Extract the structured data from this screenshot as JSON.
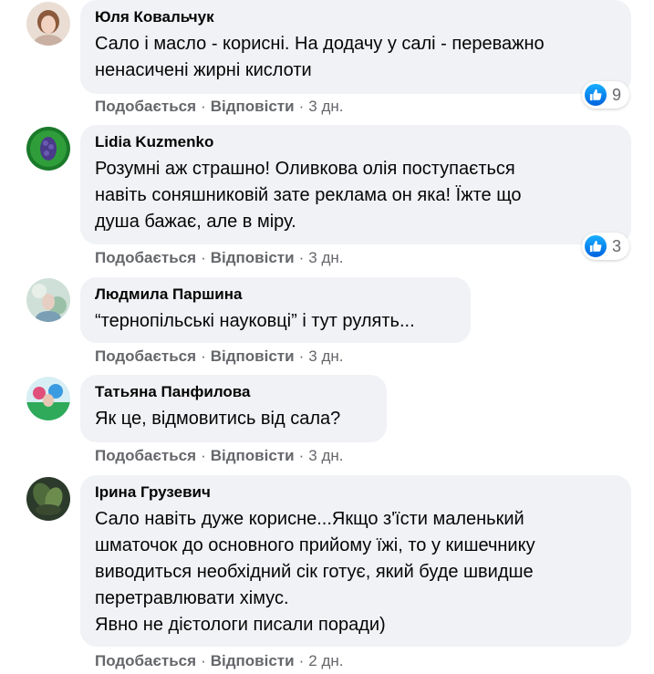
{
  "ui": {
    "like_label": "Подобається",
    "reply_label": "Відповісти",
    "separator": "·"
  },
  "comments": [
    {
      "author": "Юля Ковальчук",
      "text": "Сало і масло - корисні. На додачу у салі - переважно\nненасичені жирні кислоти",
      "time": "3 дн.",
      "reactions": {
        "icon": "like-icon",
        "count": "9"
      }
    },
    {
      "author": "Lidia Kuzmenko",
      "text": "Розумні аж страшно! Оливкова олія поступається\nнавіть соняшниковій зате реклама он яка! Їжте що\nдуша бажає, але в міру.",
      "time": "3 дн.",
      "reactions": {
        "icon": "like-icon",
        "count": "3"
      }
    },
    {
      "author": "Людмила Паршина",
      "text": "“тернопільські науковці” і тут рулять...",
      "time": "3 дн."
    },
    {
      "author": "Татьяна Панфилова",
      "text": "Як це, відмовитись від сала?",
      "time": "3 дн."
    },
    {
      "author": "Ірина Грузевич",
      "text": "Сало навіть дуже корисне...Якщо з'їсти маленький\nшматочок до основного прийому їжі, то у кишечнику\nвиводиться необхідний сік готує, який буде швидше\nперетравлювати хімус.\nЯвно не дієтологи писали поради)",
      "time": "2 дн."
    }
  ]
}
